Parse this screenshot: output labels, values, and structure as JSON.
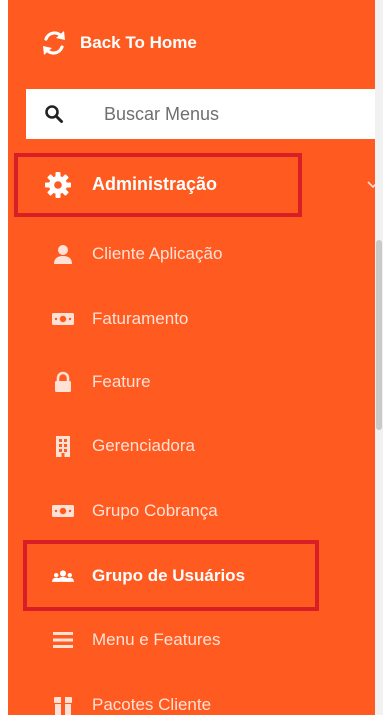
{
  "back_home": {
    "label": "Back To Home"
  },
  "search": {
    "placeholder": "Buscar Menus",
    "value": ""
  },
  "section": {
    "label": "Administração"
  },
  "menu": {
    "items": [
      {
        "label": "Cliente Aplicação",
        "icon": "user-icon"
      },
      {
        "label": "Faturamento",
        "icon": "money-icon"
      },
      {
        "label": "Feature",
        "icon": "lock-icon"
      },
      {
        "label": "Gerenciadora",
        "icon": "building-icon"
      },
      {
        "label": "Grupo Cobrança",
        "icon": "money-icon"
      },
      {
        "label": "Grupo de Usuários",
        "icon": "users-icon",
        "active": true
      },
      {
        "label": "Menu e Features",
        "icon": "bars-icon"
      },
      {
        "label": "Pacotes Cliente",
        "icon": "package-icon"
      }
    ]
  },
  "colors": {
    "sidebar_bg": "#ff5a1f",
    "highlight_border": "#d81f26",
    "text": "#ffffff"
  }
}
